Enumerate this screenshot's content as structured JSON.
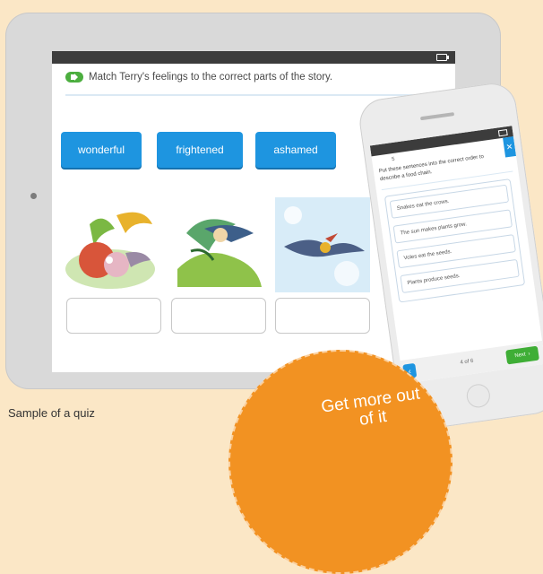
{
  "quiz": {
    "instruction": "Match Terry's feelings to the correct parts of the story.",
    "words": [
      "wonderful",
      "frightened",
      "ashamed"
    ]
  },
  "phone": {
    "counter": "5",
    "instruction": "Put these sentences into the correct order to describe a food chain.",
    "items": [
      "Snakes eat the crows.",
      "The sun makes plants grow.",
      "Voles eat the seeds.",
      "Plants produce seeds."
    ],
    "page": "4 of 6",
    "next_label": "Next"
  },
  "caption": "Sample of a quiz",
  "promo": "Get more out of it"
}
